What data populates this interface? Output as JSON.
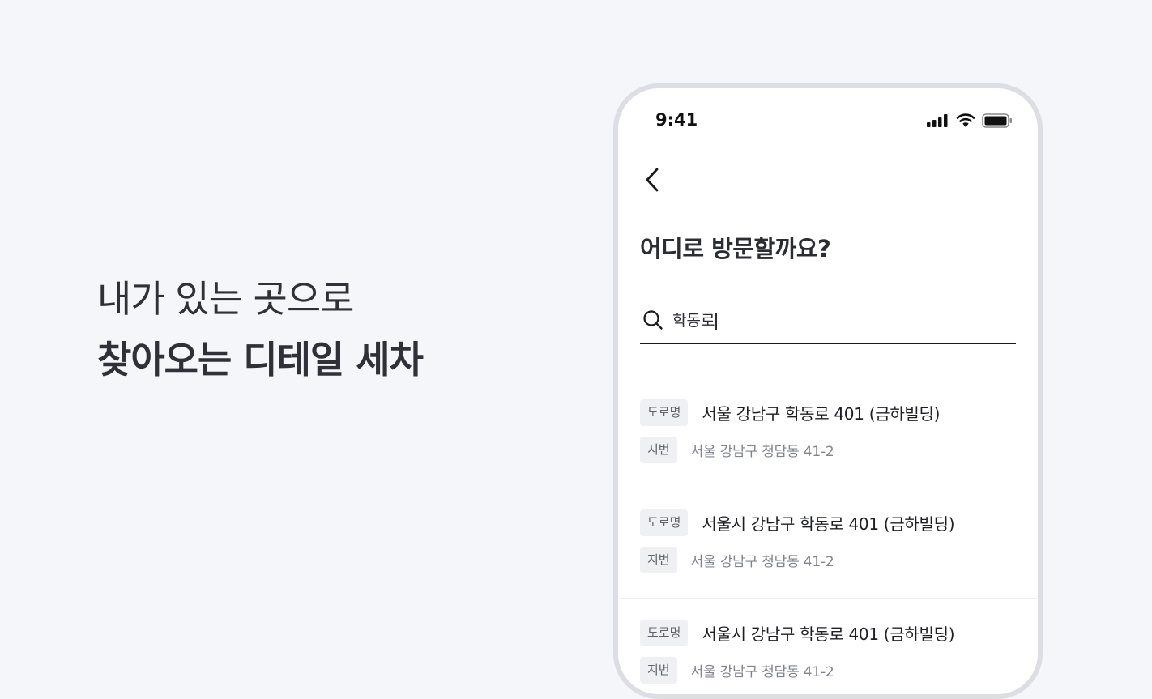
{
  "hero": {
    "line1": "내가 있는 곳으로",
    "line2": "찾아오는 디테일 세차"
  },
  "status_bar": {
    "time": "9:41",
    "icons": [
      "signal-icon",
      "wifi-icon",
      "battery-icon"
    ]
  },
  "header": {
    "back_icon": "chevron-left-icon",
    "title": "어디로 방문할까요?"
  },
  "search": {
    "icon": "search-icon",
    "value": "학동로"
  },
  "results": [
    {
      "road_tag": "도로명",
      "road_address": "서울 강남구 학동로 401 (금하빌딩)",
      "lot_tag": "지번",
      "lot_address": "서울 강남구 청담동 41-2"
    },
    {
      "road_tag": "도로명",
      "road_address": "서울시 강남구 학동로 401 (금하빌딩)",
      "lot_tag": "지번",
      "lot_address": "서울 강남구 청담동 41-2"
    },
    {
      "road_tag": "도로명",
      "road_address": "서울시 강남구 학동로 401 (금하빌딩)",
      "lot_tag": "지번",
      "lot_address": "서울 강남구 청담동 41-2"
    }
  ],
  "colors": {
    "background": "#f5f6fa",
    "phone_frame": "#dcdee4",
    "tag_background": "#eff0f3",
    "underline": "#1a1b1f"
  }
}
